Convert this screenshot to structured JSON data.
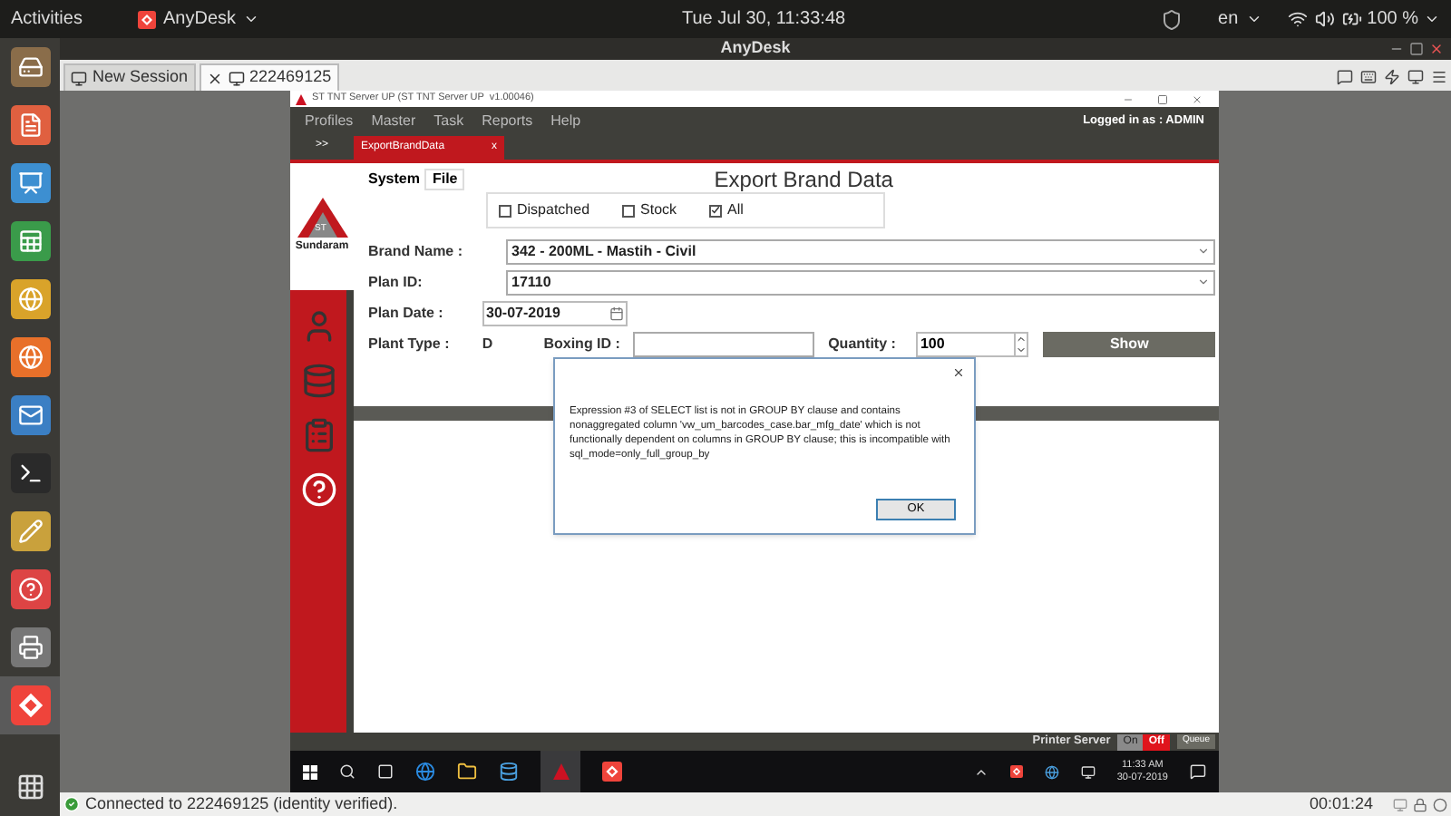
{
  "topbar": {
    "activities": "Activities",
    "app_menu": "AnyDesk",
    "clock": "Tue Jul 30, 11:33:48",
    "language": "en",
    "battery": "100 %"
  },
  "anydesk": {
    "title": "AnyDesk",
    "tabs": [
      {
        "kind": "new",
        "label": "New Session",
        "selected": false
      },
      {
        "kind": "session",
        "label": "222469125",
        "selected": true
      }
    ],
    "status": "Connected to 222469125 (identity verified).",
    "timer": "00:01:24"
  },
  "remote": {
    "app_title": "ST TNT Server UP (ST TNT Server UP  v1.00046)",
    "menu": [
      "Profiles",
      "Master",
      "Task",
      "Reports",
      "Help"
    ],
    "login": "Logged in as : ADMIN",
    "nav_toggle": ">>",
    "doc_tab": {
      "label": "ExportBrandData",
      "close": "x"
    },
    "logo": {
      "badge": "ST",
      "name": "Sundaram"
    },
    "sub_tabs": [
      {
        "label": "System",
        "selected": false
      },
      {
        "label": "File",
        "selected": true
      }
    ],
    "heading": "Export Brand Data",
    "filters": [
      {
        "label": "Dispatched",
        "checked": false
      },
      {
        "label": "Stock",
        "checked": false
      },
      {
        "label": "All",
        "checked": true
      }
    ],
    "brand_name": {
      "label": "Brand Name :",
      "value": "342 - 200ML - Mastih - Civil"
    },
    "plan_id": {
      "label": "Plan ID:",
      "value": "17110"
    },
    "plan_date": {
      "label": "Plan Date :",
      "value": "30-07-2019"
    },
    "plant_type": {
      "label": "Plant Type :",
      "value": "D"
    },
    "boxing_id": {
      "label": "Boxing ID :"
    },
    "quantity": {
      "label": "Quantity :",
      "value": "100"
    },
    "show_button": "Show",
    "printer": {
      "label": "Printer Server",
      "on_label": "On",
      "off_label": "Off",
      "on": false,
      "queue": "Queue"
    },
    "taskbar": {
      "time": "11:33 AM",
      "date": "30-07-2019"
    }
  },
  "dialog": {
    "message": "Expression #3 of SELECT list is not in GROUP BY clause and contains nonaggregated column 'vw_um_barcodes_case.bar_mfg_date' which is not functionally dependent on columns in GROUP BY clause; this is incompatible with sql_mode=only_full_group_by",
    "ok": "OK"
  }
}
